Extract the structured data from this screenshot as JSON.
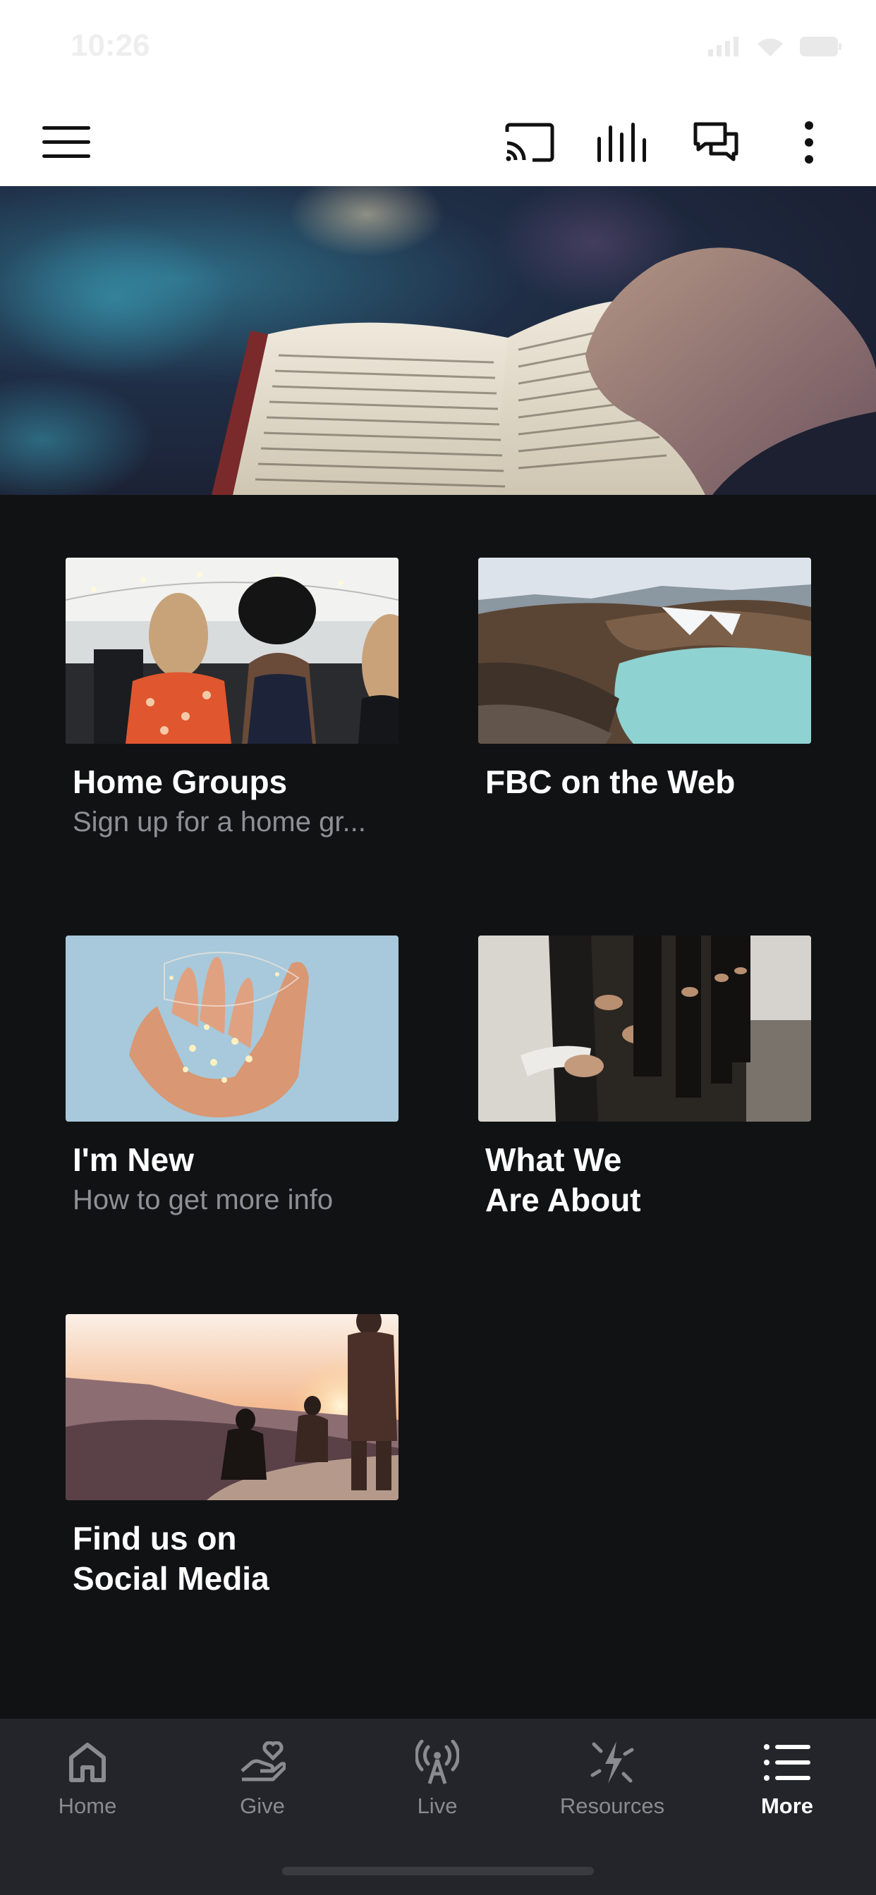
{
  "status_bar": {
    "time": "10:26"
  },
  "app_bar": {
    "menu_icon": "hamburger-menu-icon",
    "actions": [
      "cast-icon",
      "audio-bars-icon",
      "chat-bubbles-icon",
      "more-vertical-icon"
    ]
  },
  "hero": {
    "image": "open-bible-held-by-hand"
  },
  "tiles": [
    {
      "title": "Home Groups",
      "subtitle": "Sign up for a home gr...",
      "image": "women-at-outdoor-gathering"
    },
    {
      "title": "FBC on the Web",
      "subtitle": "",
      "image": "crater-lake-landscape"
    },
    {
      "title": "I'm New",
      "subtitle": "How to get more info",
      "image": "hands-holding-fairy-lights"
    },
    {
      "title": "What We\nAre About",
      "subtitle": "",
      "image": "people-worshipping"
    },
    {
      "title": "Find us on\nSocial Media",
      "subtitle": "",
      "image": "friends-at-sunset-hilltop"
    }
  ],
  "bottom_nav": {
    "items": [
      {
        "label": "Home",
        "icon": "home-icon"
      },
      {
        "label": "Give",
        "icon": "give-heart-hand-icon"
      },
      {
        "label": "Live",
        "icon": "broadcast-antenna-icon"
      },
      {
        "label": "Resources",
        "icon": "resources-icon"
      },
      {
        "label": "More",
        "icon": "list-icon"
      }
    ],
    "active": "More"
  },
  "colors": {
    "background": "#111214",
    "app_bar": "#ffffff",
    "nav_bar": "#24252b",
    "nav_inactive": "#8a8b91",
    "nav_active": "#ffffff",
    "subtitle": "#8f9095"
  }
}
